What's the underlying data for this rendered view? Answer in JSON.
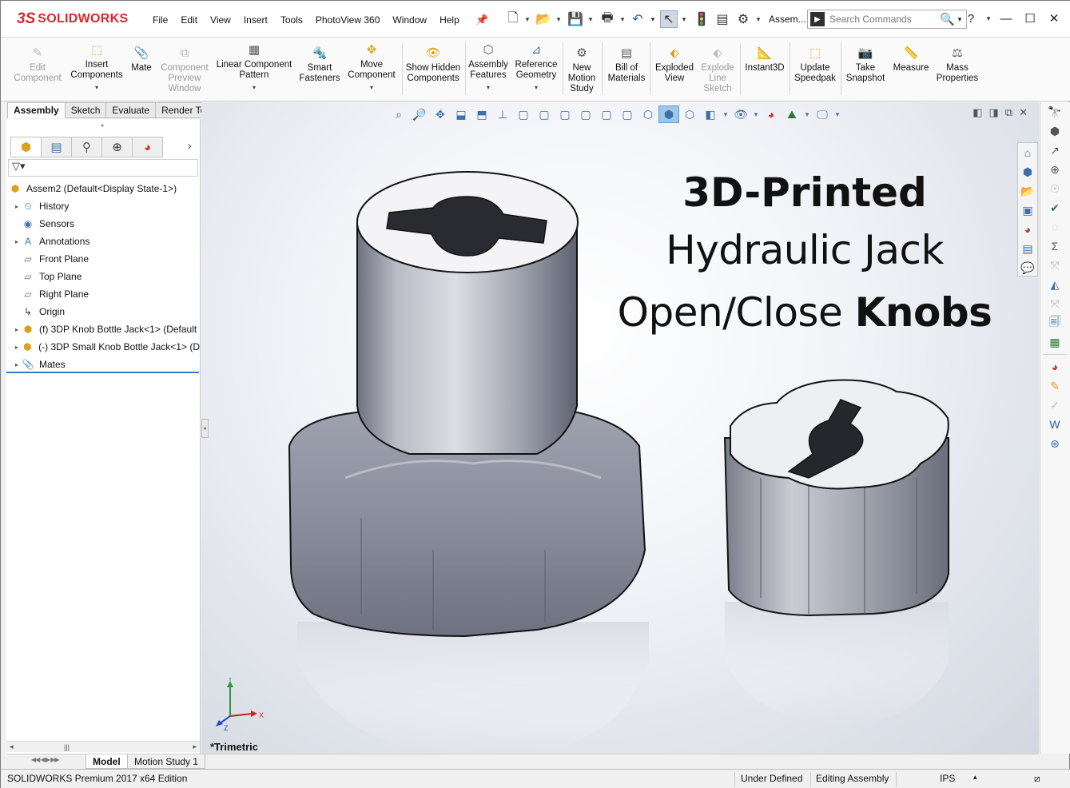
{
  "app": {
    "logo_ds": "3S",
    "logo_name": "SOLIDWORKS"
  },
  "menu": [
    "File",
    "Edit",
    "View",
    "Insert",
    "Tools",
    "PhotoView 360",
    "Window",
    "Help"
  ],
  "document_name": "Assem...",
  "search": {
    "placeholder": "Search Commands"
  },
  "command_manager": {
    "edit_component": "Edit Component",
    "insert_components": "Insert Components",
    "mate": "Mate",
    "component_preview_window": "Component Preview Window",
    "linear_component_pattern": "Linear Component Pattern",
    "smart_fasteners": "Smart Fasteners",
    "move_component": "Move Component",
    "show_hidden_components": "Show Hidden Components",
    "assembly_features": "Assembly Features",
    "reference_geometry": "Reference Geometry",
    "new_motion_study": "New Motion Study",
    "bill_of_materials": "Bill of Materials",
    "exploded_view": "Exploded View",
    "explode_line_sketch": "Explode Line Sketch",
    "instant3d": "Instant3D",
    "update_speedpak": "Update Speedpak",
    "take_snapshot": "Take Snapshot",
    "measure": "Measure",
    "mass_properties": "Mass Properties"
  },
  "tabs": [
    "Assembly",
    "Sketch",
    "Evaluate",
    "Render Tools"
  ],
  "feature_tree": {
    "root": "Assem2  (Default<Display State-1>)",
    "items": [
      {
        "label": "History",
        "expandable": true
      },
      {
        "label": "Sensors",
        "expandable": false
      },
      {
        "label": "Annotations",
        "expandable": true
      },
      {
        "label": "Front Plane",
        "expandable": false
      },
      {
        "label": "Top Plane",
        "expandable": false
      },
      {
        "label": "Right Plane",
        "expandable": false
      },
      {
        "label": "Origin",
        "expandable": false
      },
      {
        "label": "(f) 3DP Knob Bottle Jack<1> (Default",
        "expandable": true
      },
      {
        "label": "(-) 3DP Small Knob Bottle Jack<1> (D",
        "expandable": true
      },
      {
        "label": "Mates",
        "expandable": true
      }
    ]
  },
  "viewport": {
    "title_line1": "3D-Printed",
    "title_line2": "Hydraulic Jack",
    "title_line3_normal": "Open/Close ",
    "title_line3_bold": "Knobs",
    "view_name": "*Trimetric",
    "triad": {
      "x": "X",
      "y": "Y",
      "z": "Z"
    }
  },
  "bottom_tabs": [
    "Model",
    "Motion Study 1"
  ],
  "status": {
    "edition": "SOLIDWORKS Premium 2017 x64 Edition",
    "definition": "Under Defined",
    "mode": "Editing Assembly",
    "units": "IPS"
  },
  "colors": {
    "brand": "#d9262c",
    "accent": "#3d78b8",
    "part": "#a9adb8"
  }
}
